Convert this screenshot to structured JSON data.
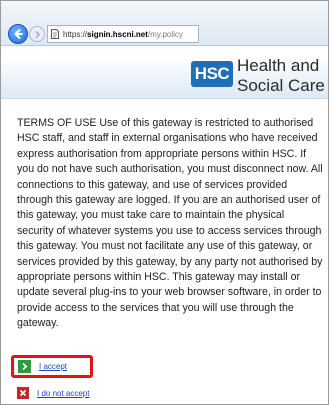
{
  "browser": {
    "url_scheme": "https://",
    "url_host": "signin.hscni.net",
    "url_path": "/my.policy",
    "icons": {
      "back": "back-arrow-icon",
      "forward": "forward-arrow-icon",
      "page": "page-icon"
    }
  },
  "header": {
    "logo_text": "HSC",
    "org_name_line1": "Health and",
    "org_name_line2": "Social Care",
    "logo_color": "#1f6fb8"
  },
  "terms": {
    "text": "TERMS OF USE Use of this gateway is restricted to authorised HSC staff, and staff in external organisations who have received express authorisation from appropriate persons within HSC. If you do not have such authorisation, you must disconnect now. All connections to this gateway, and use of services provided through this gateway are logged. If you are an authorised user of this gateway, you must take care to maintain the physical security of whatever systems you use to access services through this gateway. You must not facilitate any use of this gateway, or services provided by this gateway, by any party not authorised by appropriate persons within HSC. This gateway may install or update several plug-ins to your web browser software, in order to provide access to the services that you will use through the gateway."
  },
  "actions": {
    "accept_label": "I accept",
    "decline_label": "I do not accept",
    "accept_icon": "chevron-right-icon",
    "decline_icon": "x-icon",
    "highlight_color": "#e0121b"
  }
}
